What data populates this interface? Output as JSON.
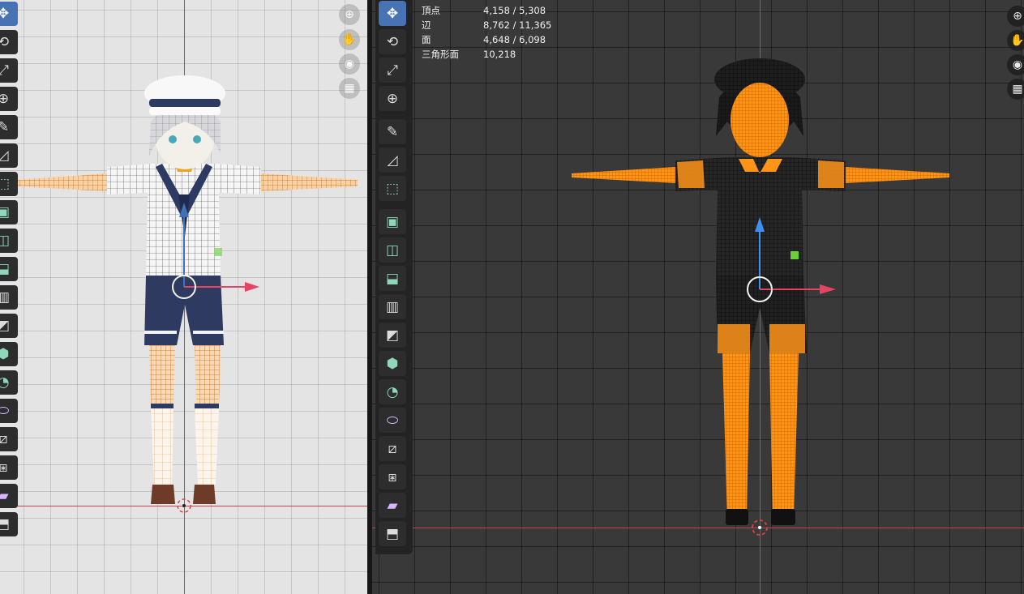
{
  "statistics": {
    "rows": [
      {
        "label": "頂点",
        "value": "4,158 / 5,308"
      },
      {
        "label": "辺",
        "value": "8,762 / 11,365"
      },
      {
        "label": "面",
        "value": "4,648 / 6,098"
      },
      {
        "label": "三角形面",
        "value": "10,218"
      }
    ]
  },
  "left_viewport": {
    "shading": "material-preview",
    "background": "#e4e4e4",
    "nav_buttons": [
      "zoom-icon",
      "hand-icon",
      "camera-icon",
      "grid-icon"
    ]
  },
  "right_viewport": {
    "shading": "wireframe",
    "background": "#393939",
    "nav_buttons": [
      "zoom-icon",
      "hand-icon",
      "camera-icon",
      "grid-icon"
    ]
  },
  "toolbar": {
    "tools": [
      {
        "id": "move",
        "icon": "move-icon",
        "glyph": "✥"
      },
      {
        "id": "rotate",
        "icon": "rotate-icon",
        "glyph": "⟲"
      },
      {
        "id": "scale",
        "icon": "scale-icon",
        "glyph": "⤢"
      },
      {
        "id": "transform",
        "icon": "transform-icon",
        "glyph": "⊕"
      },
      {
        "id": "annotate",
        "icon": "annotate-icon",
        "glyph": "✎"
      },
      {
        "id": "measure",
        "icon": "measure-icon",
        "glyph": "◿"
      },
      {
        "id": "add-cube",
        "icon": "add-cube-icon",
        "glyph": "⬚"
      },
      {
        "id": "extrude",
        "icon": "extrude-icon",
        "glyph": "▣"
      },
      {
        "id": "inset",
        "icon": "inset-icon",
        "glyph": "◫"
      },
      {
        "id": "bevel",
        "icon": "bevel-icon",
        "glyph": "⬓"
      },
      {
        "id": "loop-cut",
        "icon": "loop-cut-icon",
        "glyph": "▥"
      },
      {
        "id": "knife",
        "icon": "knife-icon",
        "glyph": "◩"
      },
      {
        "id": "poly-build",
        "icon": "poly-build-icon",
        "glyph": "⬢"
      },
      {
        "id": "spin",
        "icon": "spin-icon",
        "glyph": "◔"
      },
      {
        "id": "smooth",
        "icon": "smooth-icon",
        "glyph": "⬭"
      },
      {
        "id": "edge-slide",
        "icon": "edge-slide-icon",
        "glyph": "⧄"
      },
      {
        "id": "shrink-fatten",
        "icon": "shrink-fatten-icon",
        "glyph": "⧆"
      },
      {
        "id": "shear",
        "icon": "shear-icon",
        "glyph": "▰"
      },
      {
        "id": "rip-region",
        "icon": "rip-region-icon",
        "glyph": "⬒"
      }
    ]
  },
  "colors": {
    "active_tool": "#4772b3",
    "axis_x": "#c04552",
    "axis_z": "#3f72b8",
    "selection": "#ff9018",
    "wire": "#121212",
    "uniform_navy": "#2d3a63"
  }
}
